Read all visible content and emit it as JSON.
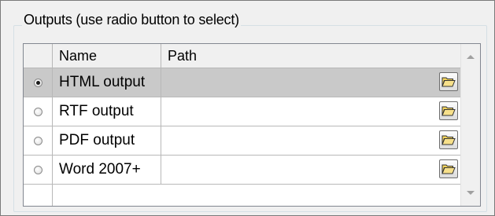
{
  "outputs_group": {
    "title": "Outputs (use radio button to select)"
  },
  "grid": {
    "columns": [
      "",
      "Name",
      "Path"
    ],
    "rows": [
      {
        "name": "HTML output",
        "path": "",
        "selected": true
      },
      {
        "name": "RTF output",
        "path": "",
        "selected": false
      },
      {
        "name": "PDF output",
        "path": "",
        "selected": false
      },
      {
        "name": "Word 2007+",
        "path": "",
        "selected": false
      }
    ]
  },
  "icons": {
    "browse": "folder-open-icon",
    "scroll_up": "scroll-up-arrow-icon",
    "scroll_down": "scroll-down-arrow-icon"
  },
  "colors": {
    "selected_row": "#c9c9c9",
    "group_border": "#d5dfe5",
    "folder_yellow": "#f2d35a"
  }
}
